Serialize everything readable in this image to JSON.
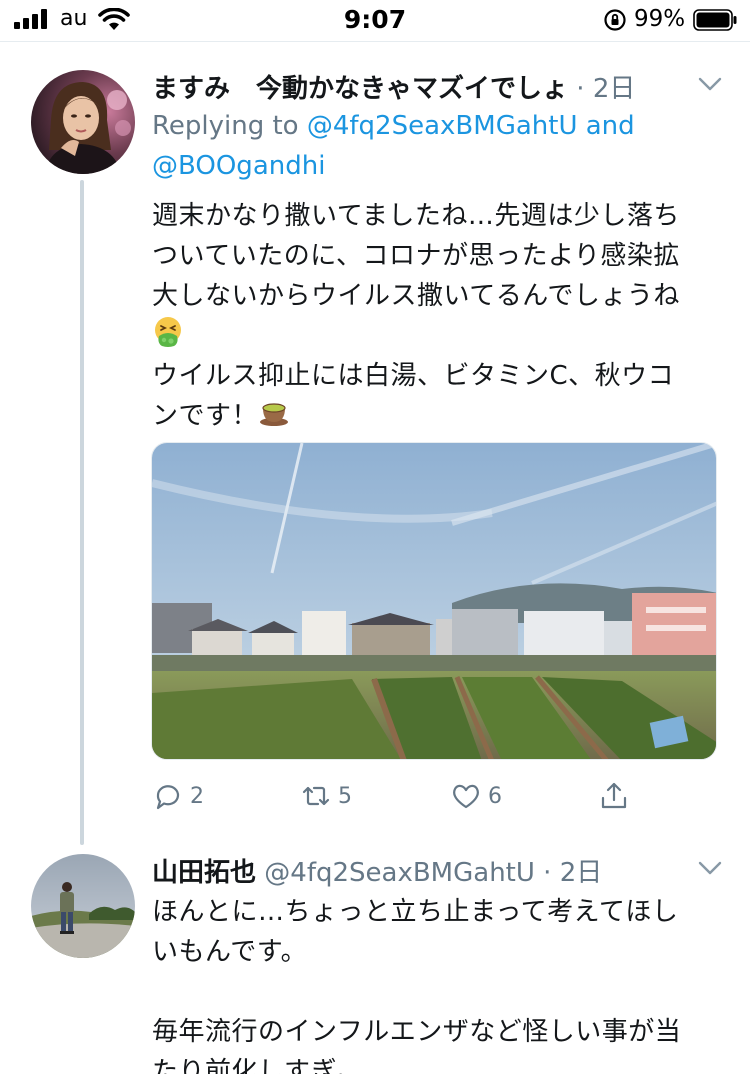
{
  "status_bar": {
    "carrier": "au",
    "time": "9:07",
    "battery": "99%"
  },
  "tweets": [
    {
      "display_name": "ますみ　今動かなきゃマズイでしょ",
      "handle": "",
      "dot": "·",
      "time": "2日",
      "replying_prefix": "Replying to ",
      "mention_1": "@4fq2SeaxBMGahtU",
      "mention_join": " and",
      "mention_2": "@BOOgandhi",
      "text_lines": [
        "週末かなり撒いてましたね…先週は少し落ち",
        "ついていたのに、コロナが思ったより感染拡",
        "大しないからウイルス撒いてるんでしょうね",
        "ウイルス抑止には白湯、ビタミンC、秋ウコ",
        "ンです！"
      ],
      "emoji_1": "nauseated-face",
      "emoji_2": "green-tea",
      "replies": "2",
      "retweets": "5",
      "likes": "6"
    },
    {
      "display_name": "山田拓也",
      "handle": "@4fq2SeaxBMGahtU",
      "dot": "·",
      "time": "2日",
      "text_lines": [
        "ほんとに…ちょっと立ち止まって考えてほし",
        "いもんです。",
        "",
        "毎年流行のインフルエンザなど怪しい事が当",
        "たり前化しすぎ。"
      ]
    }
  ],
  "colors": {
    "link": "#1b95e0",
    "muted": "#657786",
    "thread_line": "#ccd6dd"
  }
}
